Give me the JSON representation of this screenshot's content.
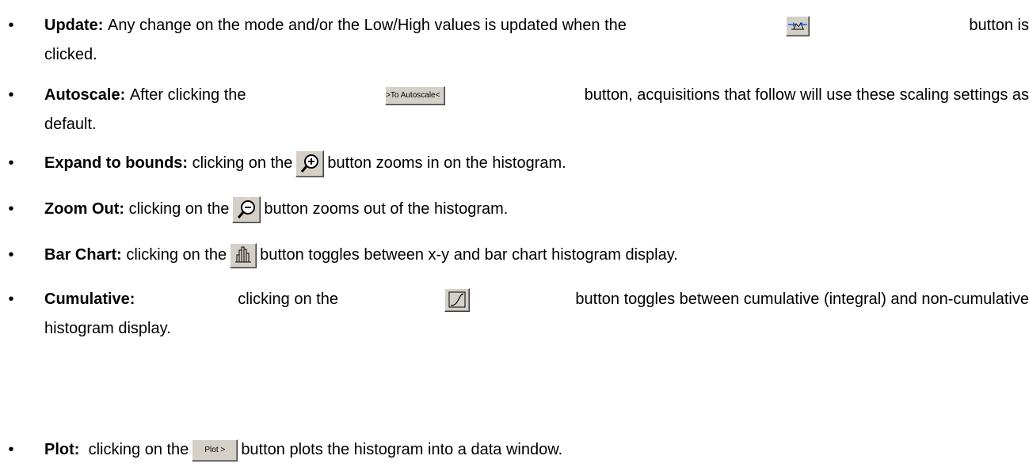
{
  "bullet_char": "•",
  "items": [
    {
      "label": "Update:",
      "lines": [
        "Any change on the mode and/or the Low/High values is updated when the",
        "button is",
        "clicked."
      ],
      "icon": "update-arrows-icon"
    },
    {
      "label": "Autoscale:",
      "lines": [
        "After clicking the",
        "button, acquisitions that follow will use these scaling settings as",
        "default."
      ],
      "button_text": ">To Autoscale<"
    },
    {
      "label": "Expand to bounds:",
      "lines": [
        "clicking on the",
        "button zooms in on the histogram."
      ],
      "icon": "zoom-in-icon"
    },
    {
      "label": "Zoom Out:",
      "lines": [
        "clicking on the",
        "button zooms out of the histogram."
      ],
      "icon": "zoom-out-icon"
    },
    {
      "label": "Bar Chart:",
      "lines": [
        "clicking on the",
        "button toggles between x-y and bar chart histogram display."
      ],
      "icon": "bar-chart-icon"
    },
    {
      "label": "Cumulative:",
      "lines": [
        "clicking on the",
        "button toggles between cumulative (integral) and non-cumulative",
        "histogram display."
      ],
      "icon": "cumulative-curve-icon"
    },
    {
      "label": "Plot:",
      "lines": [
        "clicking on the",
        "button plots the histogram into a data window."
      ],
      "button_text": "Plot >"
    }
  ]
}
